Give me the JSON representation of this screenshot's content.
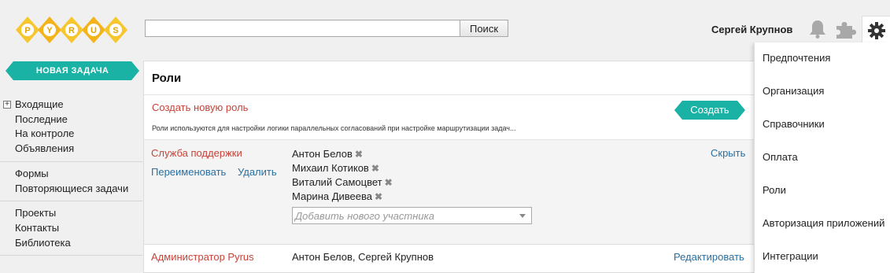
{
  "logo": {
    "letters": [
      "P",
      "Y",
      "R",
      "U",
      "S"
    ],
    "colors": [
      "#f7c62f",
      "#f3b31a"
    ]
  },
  "search": {
    "value": "",
    "placeholder": "",
    "button_label": "Поиск"
  },
  "header": {
    "user_name": "Сергей Крупнов",
    "icons": [
      "bell-icon",
      "puzzle-icon",
      "gear-icon"
    ]
  },
  "new_task": {
    "label": "НОВАЯ ЗАДАЧА",
    "color": "#1ab2a5"
  },
  "sidebar": {
    "groups": [
      {
        "items": [
          "Входящие",
          "Последние",
          "На контроле",
          "Объявления"
        ]
      },
      {
        "items": [
          "Формы",
          "Повторяющиеся задачи"
        ]
      },
      {
        "items": [
          "Проекты",
          "Контакты",
          "Библиотека"
        ]
      }
    ],
    "expand_icon": "+"
  },
  "main": {
    "title": "Роли",
    "create": {
      "title": "Создать новую роль",
      "button_label": "Создать",
      "description": "Роли используются для настройки логики параллельных согласований при настройке маршрутизации задач..."
    },
    "roles": [
      {
        "name": "Служба поддержки",
        "rename_label": "Переименовать",
        "delete_label": "Удалить",
        "toggle_label": "Скрыть",
        "members": [
          "Антон Белов",
          "Михаил Котиков",
          "Виталий Самоцвет",
          "Марина Дивеева"
        ],
        "remove_glyph": "✖",
        "add_placeholder": "Добавить нового участника"
      },
      {
        "name": "Администратор Pyrus",
        "members_text": "Антон Белов, Сергей Крупнов",
        "edit_label": "Редактировать"
      }
    ]
  },
  "settings_menu": {
    "items": [
      "Предпочтения",
      "Организация",
      "Справочники",
      "Оплата",
      "Роли",
      "Авторизация приложений",
      "Интеграции"
    ]
  },
  "colors": {
    "accent_teal": "#1ab2a5",
    "role_red": "#c84238",
    "link_blue": "#2a6fa0"
  }
}
